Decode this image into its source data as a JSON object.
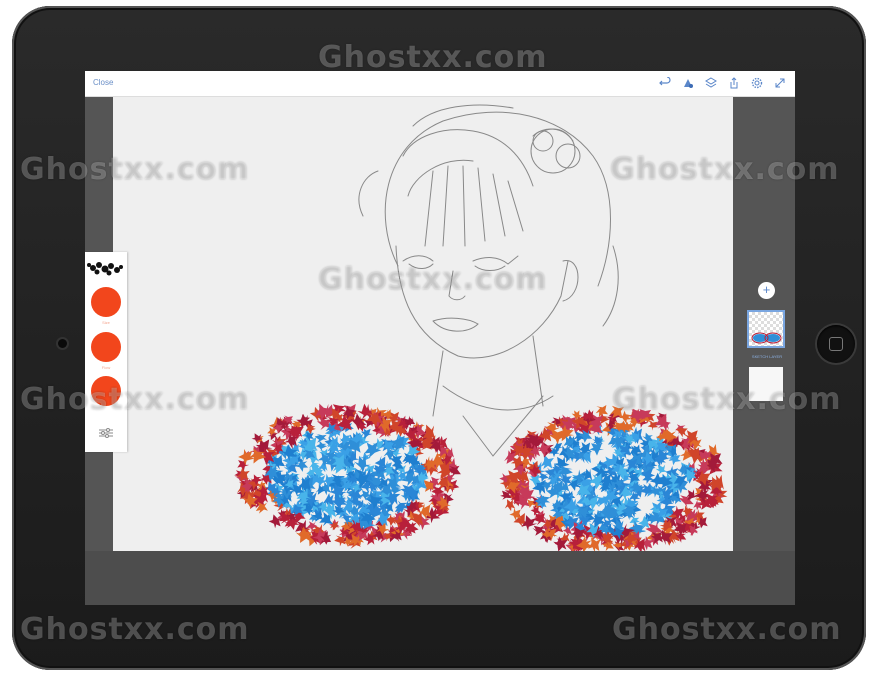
{
  "toolbar": {
    "close_label": "Close",
    "icons": [
      "undo-icon",
      "brush-icon",
      "layers-icon",
      "share-icon",
      "settings-icon",
      "fullscreen-icon"
    ]
  },
  "left_panel": {
    "swatches": [
      {
        "label": "Size",
        "color": "#f2461c"
      },
      {
        "label": "Flow",
        "color": "#f2461c"
      },
      {
        "label": "",
        "color": "#f2461c"
      }
    ]
  },
  "layers": {
    "add_label": "+",
    "active_layer_label": "SKETCH LAYER"
  },
  "watermark": "Ghostxx.com",
  "colors": {
    "accent": "#5a86c9",
    "brush": "#f2461c",
    "canvas": "#efefef",
    "leaf_blue": "#2f8fd8",
    "leaf_red": "#b8203a"
  }
}
